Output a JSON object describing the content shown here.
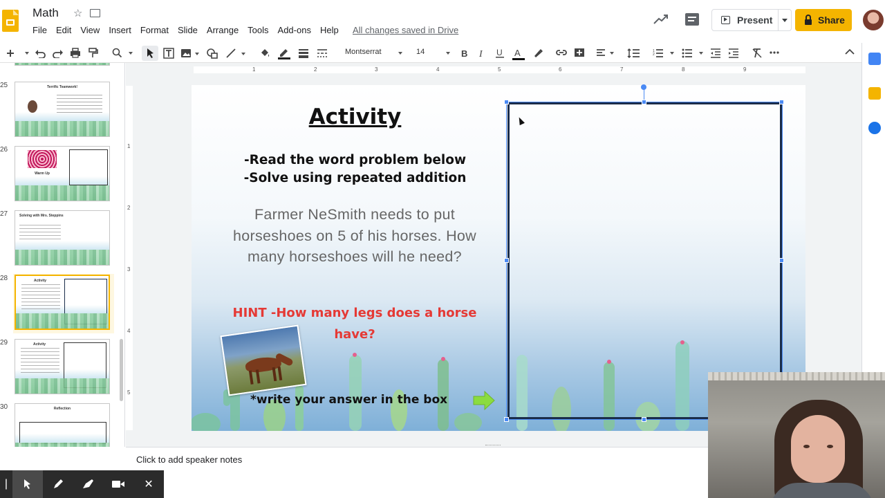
{
  "header": {
    "title": "Math",
    "menu": [
      "File",
      "Edit",
      "View",
      "Insert",
      "Format",
      "Slide",
      "Arrange",
      "Tools",
      "Add-ons",
      "Help"
    ],
    "saved_status": "All changes saved in Drive",
    "present_label": "Present",
    "share_label": "Share"
  },
  "toolbar": {
    "font": "Montserrat",
    "font_size": "14"
  },
  "ruler": {
    "h_ticks": [
      "1",
      "2",
      "3",
      "4",
      "5",
      "6",
      "7",
      "8",
      "9"
    ],
    "v_ticks": [
      "1",
      "2",
      "3",
      "4",
      "5"
    ]
  },
  "filmstrip": {
    "slides": [
      {
        "num": "25",
        "title": "Terrific Teamwork!"
      },
      {
        "num": "26",
        "title": "Warm Up"
      },
      {
        "num": "27",
        "title": "Solving with Mrs. Steppins"
      },
      {
        "num": "28",
        "title": "Activity",
        "selected": true
      },
      {
        "num": "29",
        "title": "Activity"
      },
      {
        "num": "30",
        "title": "Reflection"
      }
    ]
  },
  "slide": {
    "title": "Activity",
    "instruction_1": "-Read the word problem below",
    "instruction_2": "-Solve using repeated addition",
    "problem": "Farmer NeSmith needs to put horseshoes on 5 of his horses. How many horseshoes will he need?",
    "hint": "HINT -How many legs does a horse have?",
    "answer_note": "*write your answer in the box"
  },
  "notes": {
    "placeholder": "Click to add speaker notes"
  },
  "colors": {
    "accent": "#f4b400",
    "selection": "#4a8af4",
    "hint": "#e53935"
  }
}
